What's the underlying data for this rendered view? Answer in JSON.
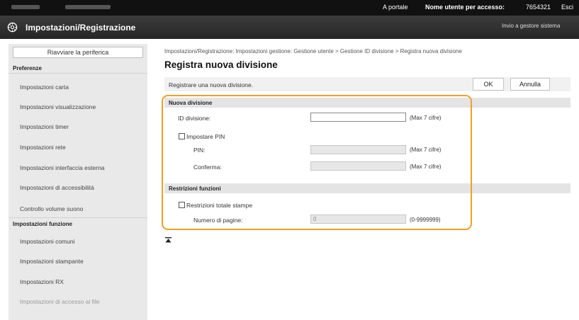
{
  "topbar": {
    "portal_link": "A portale",
    "user_label": "Nome utente per accesso:",
    "user_value": "7654321",
    "logout_label": "Esci"
  },
  "header": {
    "app_title": "Impostazioni/Registrazione",
    "send_to_admin": "Invio a gestore sistema",
    "logo_icon": "canon-gear-icon"
  },
  "sidebar": {
    "restart_button": "Riavviare la periferica",
    "sections": [
      {
        "title": "Preferenze",
        "items": [
          "Impostazioni carta",
          "Impostazioni visualizzazione",
          "Impostazioni timer",
          "Impostazioni rete",
          "Impostazioni interfaccia esterna",
          "Impostazioni di accessibilità",
          "Controllo volume suono"
        ]
      },
      {
        "title": "Impostazioni funzione",
        "items": [
          "Impostazioni comuni",
          "Impostazioni stampante",
          "Impostazioni RX",
          "Impostazioni di accesso ai file"
        ]
      }
    ]
  },
  "main": {
    "breadcrumb": "Impostazioni/Registrazione: Impostazioni gestione: Gestione utente > Gestione ID divisione > Registra nuova divisione",
    "title": "Registra nuova divisione",
    "description": "Registrare una nuova divisione.",
    "ok_button": "OK",
    "cancel_button": "Annulla",
    "new_division": {
      "header": "Nuova divisione",
      "id_label": "ID divisione:",
      "id_value": "",
      "id_hint": "(Max 7 cifre)",
      "set_pin_label": "Impostare PIN",
      "set_pin_checked": false,
      "pin_label": "PIN:",
      "pin_hint": "(Max 7 cifre)",
      "confirm_label": "Conferma:",
      "confirm_hint": "(Max 7 cifre)"
    },
    "restrictions": {
      "header": "Restrizioni funzioni",
      "total_print_label": "Restrizioni totale stampe",
      "total_print_checked": false,
      "pages_label": "Numero di pagine:",
      "pages_value": "0",
      "pages_hint": "(0-9999999)"
    },
    "scroll_top_icon": "scroll-to-top-icon"
  },
  "colors": {
    "highlight_frame": "#f0a025",
    "topbar_bg": "#111111",
    "sidebar_bg": "#e9e9e9"
  }
}
